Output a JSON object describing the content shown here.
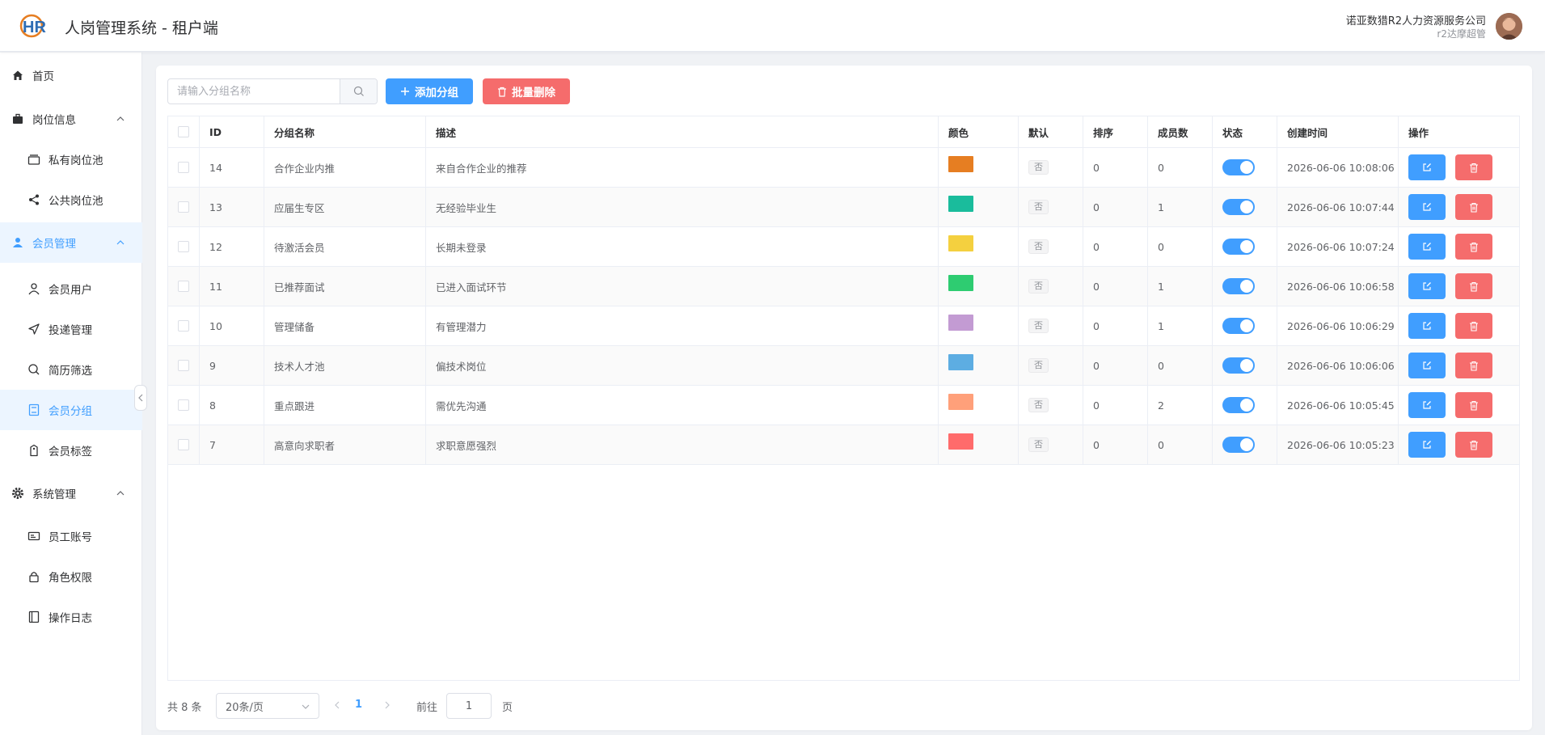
{
  "header": {
    "logo_text": "HR",
    "title": "人岗管理系统 - 租户端",
    "company": "诺亚数猎R2人力资源服务公司",
    "role": "r2达摩超管"
  },
  "sidebar": {
    "items": [
      {
        "label": "首页",
        "icon": "home-icon"
      },
      {
        "label": "岗位信息",
        "icon": "briefcase-icon"
      },
      {
        "label": "私有岗位池",
        "icon": "stack-icon"
      },
      {
        "label": "公共岗位池",
        "icon": "share-icon"
      },
      {
        "label": "会员管理",
        "icon": "user-icon"
      },
      {
        "label": "会员用户",
        "icon": "user-outline-icon"
      },
      {
        "label": "投递管理",
        "icon": "send-icon"
      },
      {
        "label": "简历筛选",
        "icon": "search-icon"
      },
      {
        "label": "会员分组",
        "icon": "group-icon"
      },
      {
        "label": "会员标签",
        "icon": "tag-icon"
      },
      {
        "label": "系统管理",
        "icon": "gear-icon"
      },
      {
        "label": "员工账号",
        "icon": "id-card-icon"
      },
      {
        "label": "角色权限",
        "icon": "lock-icon"
      },
      {
        "label": "操作日志",
        "icon": "notebook-icon"
      }
    ]
  },
  "toolbar": {
    "search_placeholder": "请输入分组名称",
    "add_label": "添加分组",
    "batch_delete_label": "批量删除"
  },
  "table": {
    "columns": [
      "ID",
      "分组名称",
      "描述",
      "颜色",
      "默认",
      "排序",
      "成员数",
      "状态",
      "创建时间",
      "操作"
    ],
    "rows": [
      {
        "id": "14",
        "name": "合作企业内推",
        "desc": "来自合作企业的推荐",
        "color": "#e67e22",
        "default": "否",
        "sort": "0",
        "members": "0",
        "enabled": true,
        "created": "2026-06-06 10:08:06"
      },
      {
        "id": "13",
        "name": "应届生专区",
        "desc": "无经验毕业生",
        "color": "#1abc9c",
        "default": "否",
        "sort": "0",
        "members": "1",
        "enabled": true,
        "created": "2026-06-06 10:07:44"
      },
      {
        "id": "12",
        "name": "待激活会员",
        "desc": "长期未登录",
        "color": "#f4d03f",
        "default": "否",
        "sort": "0",
        "members": "0",
        "enabled": true,
        "created": "2026-06-06 10:07:24"
      },
      {
        "id": "11",
        "name": "已推荐面试",
        "desc": "已进入面试环节",
        "color": "#2ecc71",
        "default": "否",
        "sort": "0",
        "members": "1",
        "enabled": true,
        "created": "2026-06-06 10:06:58"
      },
      {
        "id": "10",
        "name": "管理储备",
        "desc": "有管理潜力",
        "color": "#c39bd3",
        "default": "否",
        "sort": "0",
        "members": "1",
        "enabled": true,
        "created": "2026-06-06 10:06:29"
      },
      {
        "id": "9",
        "name": "技术人才池",
        "desc": "偏技术岗位",
        "color": "#5dade2",
        "default": "否",
        "sort": "0",
        "members": "0",
        "enabled": true,
        "created": "2026-06-06 10:06:06"
      },
      {
        "id": "8",
        "name": "重点跟进",
        "desc": "需优先沟通",
        "color": "#ffa07a",
        "default": "否",
        "sort": "0",
        "members": "2",
        "enabled": true,
        "created": "2026-06-06 10:05:45"
      },
      {
        "id": "7",
        "name": "高意向求职者",
        "desc": "求职意愿强烈",
        "color": "#ff6b6b",
        "default": "否",
        "sort": "0",
        "members": "0",
        "enabled": true,
        "created": "2026-06-06 10:05:23"
      }
    ]
  },
  "pagination": {
    "total": "共 8 条",
    "page_size": "20条/页",
    "current": "1",
    "goto_label": "前往",
    "goto_value": "1",
    "page_suffix": "页"
  },
  "colors": {
    "primary": "#409eff",
    "danger": "#f56c6c",
    "active_bg": "#ecf5ff"
  }
}
